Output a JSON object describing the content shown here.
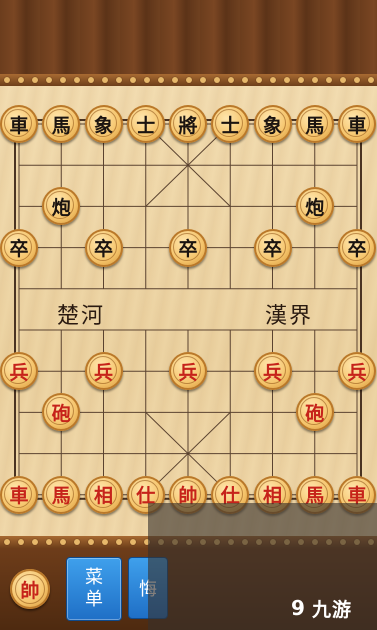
{
  "board": {
    "river_left": "楚河",
    "river_right": "漢界"
  },
  "pieces": {
    "black": [
      {
        "label": "車",
        "file": 0,
        "rank": 0
      },
      {
        "label": "馬",
        "file": 1,
        "rank": 0
      },
      {
        "label": "象",
        "file": 2,
        "rank": 0
      },
      {
        "label": "士",
        "file": 3,
        "rank": 0
      },
      {
        "label": "將",
        "file": 4,
        "rank": 0
      },
      {
        "label": "士",
        "file": 5,
        "rank": 0
      },
      {
        "label": "象",
        "file": 6,
        "rank": 0
      },
      {
        "label": "馬",
        "file": 7,
        "rank": 0
      },
      {
        "label": "車",
        "file": 8,
        "rank": 0
      },
      {
        "label": "炮",
        "file": 1,
        "rank": 2
      },
      {
        "label": "炮",
        "file": 7,
        "rank": 2
      },
      {
        "label": "卒",
        "file": 0,
        "rank": 3
      },
      {
        "label": "卒",
        "file": 2,
        "rank": 3
      },
      {
        "label": "卒",
        "file": 4,
        "rank": 3
      },
      {
        "label": "卒",
        "file": 6,
        "rank": 3
      },
      {
        "label": "卒",
        "file": 8,
        "rank": 3
      }
    ],
    "red": [
      {
        "label": "兵",
        "file": 0,
        "rank": 6
      },
      {
        "label": "兵",
        "file": 2,
        "rank": 6
      },
      {
        "label": "兵",
        "file": 4,
        "rank": 6
      },
      {
        "label": "兵",
        "file": 6,
        "rank": 6
      },
      {
        "label": "兵",
        "file": 8,
        "rank": 6
      },
      {
        "label": "砲",
        "file": 1,
        "rank": 7
      },
      {
        "label": "砲",
        "file": 7,
        "rank": 7
      },
      {
        "label": "車",
        "file": 0,
        "rank": 9
      },
      {
        "label": "馬",
        "file": 1,
        "rank": 9
      },
      {
        "label": "相",
        "file": 2,
        "rank": 9
      },
      {
        "label": "仕",
        "file": 3,
        "rank": 9
      },
      {
        "label": "帥",
        "file": 4,
        "rank": 9
      },
      {
        "label": "仕",
        "file": 5,
        "rank": 9
      },
      {
        "label": "相",
        "file": 6,
        "rank": 9
      },
      {
        "label": "馬",
        "file": 7,
        "rank": 9
      },
      {
        "label": "車",
        "file": 8,
        "rank": 9
      }
    ]
  },
  "toolbar": {
    "turn_piece": "帥",
    "menu_label_line1": "菜",
    "menu_label_line2": "单",
    "second_button_label": "悔"
  },
  "watermark": {
    "logo": "9",
    "text": "九游"
  },
  "colors": {
    "red_piece_text": "#c6231a",
    "black_piece_text": "#1b1410",
    "button_blue": "#1f6fc6"
  }
}
